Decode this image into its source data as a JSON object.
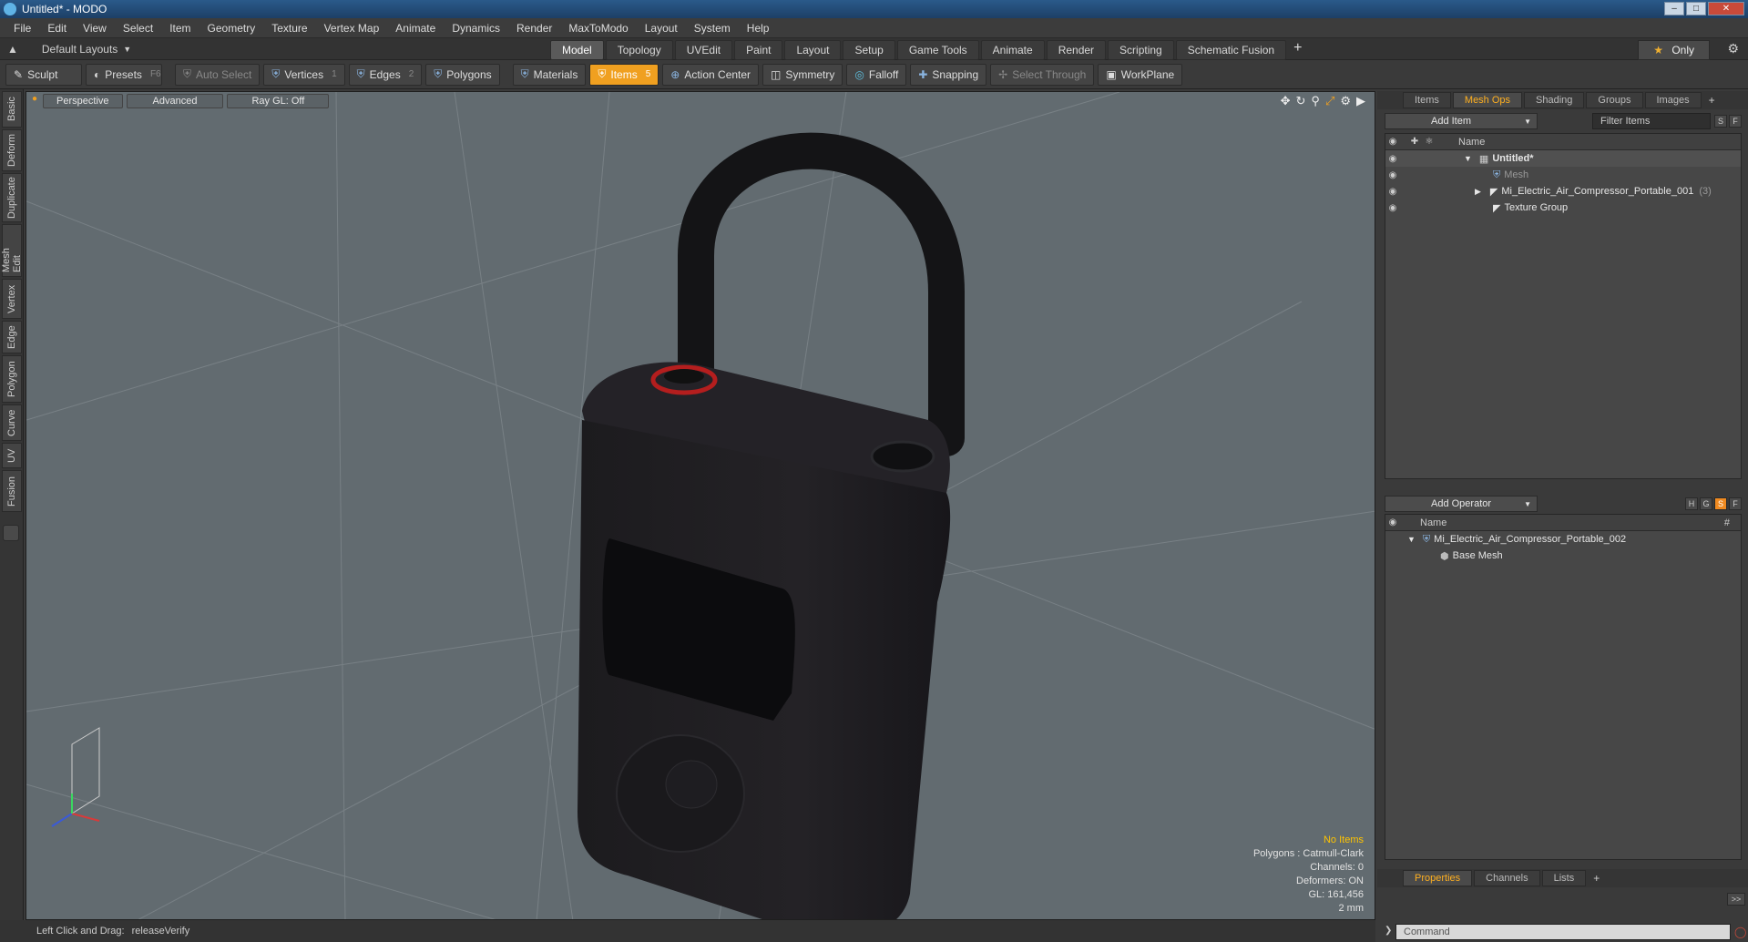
{
  "window": {
    "title": "Untitled* - MODO"
  },
  "menu": [
    "File",
    "Edit",
    "View",
    "Select",
    "Item",
    "Geometry",
    "Texture",
    "Vertex Map",
    "Animate",
    "Dynamics",
    "Render",
    "MaxToModo",
    "Layout",
    "System",
    "Help"
  ],
  "layoutbar": {
    "layout_select": "Default Layouts",
    "tabs": [
      "Model",
      "Topology",
      "UVEdit",
      "Paint",
      "Layout",
      "Setup",
      "Game Tools",
      "Animate",
      "Render",
      "Scripting",
      "Schematic Fusion"
    ],
    "active_tab": "Model",
    "plus": "+",
    "only_label": "Only"
  },
  "toolbar": {
    "sculpt": "Sculpt",
    "presets": "Presets",
    "presets_key": "F6",
    "auto_select": "Auto Select",
    "vertices": "Vertices",
    "vertices_key": "1",
    "edges": "Edges",
    "edges_key": "2",
    "polygons": "Polygons",
    "materials": "Materials",
    "items": "Items",
    "items_key": "5",
    "action_center": "Action Center",
    "symmetry": "Symmetry",
    "falloff": "Falloff",
    "snapping": "Snapping",
    "select_through": "Select Through",
    "workplane": "WorkPlane"
  },
  "left_tabs": [
    "Basic",
    "Deform",
    "Duplicate",
    "Mesh Edit",
    "Vertex",
    "Edge",
    "Polygon",
    "Curve",
    "UV",
    "Fusion"
  ],
  "viewport": {
    "view_mode": "Perspective",
    "shading": "Advanced",
    "raygl": "Ray GL: Off",
    "stats": {
      "no_items": "No Items",
      "polygons": "Polygons : Catmull-Clark",
      "channels": "Channels: 0",
      "deformers": "Deformers: ON",
      "gl": "GL: 161,456",
      "unit": "2 mm"
    }
  },
  "status": {
    "hint_label": "Left Click and Drag:",
    "hint_value": "releaseVerify"
  },
  "items_panel": {
    "tabs": [
      "Items",
      "Mesh Ops",
      "Shading",
      "Groups",
      "Images"
    ],
    "active_tab": "Mesh Ops",
    "add_item": "Add Item",
    "filter_placeholder": "Filter Items",
    "s_btn": "S",
    "f_btn": "F",
    "col_name": "Name",
    "rows": [
      {
        "label": "Untitled*",
        "extra": ""
      },
      {
        "label": "Mesh",
        "extra": ""
      },
      {
        "label": "Mi_Electric_Air_Compressor_Portable_001",
        "extra": "(3)"
      },
      {
        "label": "Texture Group",
        "extra": ""
      }
    ]
  },
  "operator_panel": {
    "add_operator": "Add Operator",
    "h_btn": "H",
    "g_btn": "G",
    "s_btn": "S",
    "f_btn": "F",
    "col_name": "Name",
    "col_hash": "#",
    "rows": [
      {
        "label": "Mi_Electric_Air_Compressor_Portable_002"
      },
      {
        "label": "Base Mesh"
      }
    ]
  },
  "bottom_panel": {
    "tabs": [
      "Properties",
      "Channels",
      "Lists"
    ],
    "active_tab": "Properties",
    "expand": ">>",
    "command_placeholder": "Command"
  },
  "colors": {
    "accent": "#f0a020",
    "viewport_bg": "#626b70"
  }
}
